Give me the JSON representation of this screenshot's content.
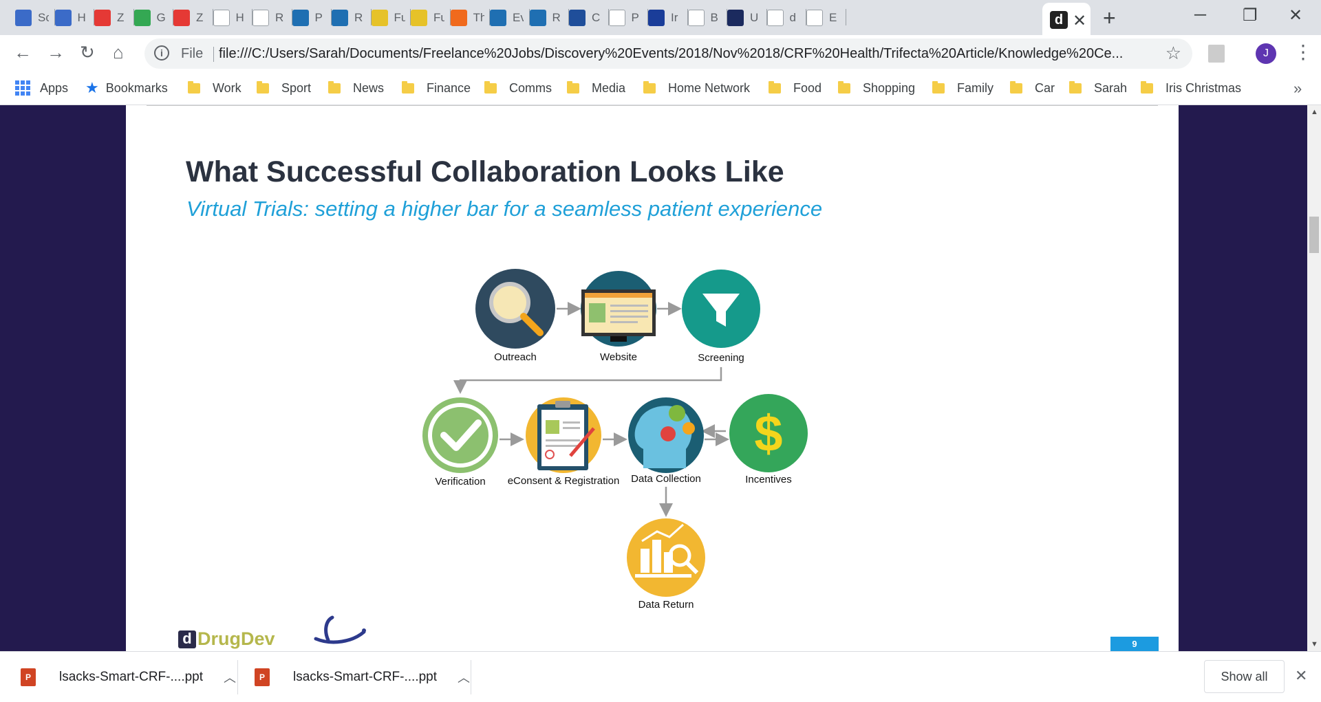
{
  "browser": {
    "tabs": [
      {
        "icon": "confluence-icon",
        "label": "Sc",
        "color": "#3b6bc8"
      },
      {
        "icon": "confluence-icon",
        "label": "H",
        "color": "#3b6bc8"
      },
      {
        "icon": "zoho-icon",
        "label": "Z",
        "color": "#e53935"
      },
      {
        "icon": "maps-icon",
        "label": "G",
        "color": "#34a853"
      },
      {
        "icon": "zoho-icon",
        "label": "Z",
        "color": "#e53935"
      },
      {
        "icon": "document-icon",
        "label": "H",
        "color": "#ffffff"
      },
      {
        "icon": "document-icon",
        "label": "R",
        "color": "#ffffff"
      },
      {
        "icon": "topra-icon",
        "label": "P",
        "color": "#1f6fb2"
      },
      {
        "icon": "raps-icon",
        "label": "R",
        "color": "#1f6fb2"
      },
      {
        "icon": "y-icon",
        "label": "Fu",
        "color": "#e6c229"
      },
      {
        "icon": "y-icon",
        "label": "Fu",
        "color": "#e6c229"
      },
      {
        "icon": "c-icon",
        "label": "Th",
        "color": "#f06a1d"
      },
      {
        "icon": "raps-icon",
        "label": "Ev",
        "color": "#1f6fb2"
      },
      {
        "icon": "raps-icon",
        "label": "R",
        "color": "#1f6fb2"
      },
      {
        "icon": "bars-icon",
        "label": "C",
        "color": "#1f4e9a"
      },
      {
        "icon": "document-icon",
        "label": "P",
        "color": "#ffffff"
      },
      {
        "icon": "eu-flag-icon",
        "label": "Ir",
        "color": "#1a3d99"
      },
      {
        "icon": "b-logo-icon",
        "label": "B",
        "color": "#ffffff"
      },
      {
        "icon": "m-logo-icon",
        "label": "U",
        "color": "#1b2a5e"
      },
      {
        "icon": "google-icon",
        "label": "d",
        "color": "#ffffff"
      },
      {
        "icon": "google-icon",
        "label": "E",
        "color": "#ffffff"
      }
    ],
    "active_tab_icon": "d",
    "new_tab": "+",
    "address": {
      "scheme": "File",
      "url": "file:///C:/Users/Sarah/Documents/Freelance%20Jobs/Discovery%20Events/2018/Nov%2018/CRF%20Health/Trifecta%20Article/Knowledge%20Ce..."
    },
    "profile_initial": "J",
    "bookmarks": {
      "apps": "Apps",
      "bookmarks": "Bookmarks",
      "folders": [
        "Work",
        "Sport",
        "News",
        "Finance",
        "Comms",
        "Media",
        "Home Network",
        "Food",
        "Shopping",
        "Family",
        "Car",
        "Sarah",
        "Iris Christmas"
      ],
      "more": "»"
    }
  },
  "slide": {
    "title": "What Successful Collaboration Looks Like",
    "subtitle": "Virtual Trials: setting a higher bar for a seamless patient experience",
    "steps": {
      "outreach": "Outreach",
      "website": "Website",
      "screening": "Screening",
      "verification": "Verification",
      "econsent": "eConsent & Registration",
      "data_collection": "Data Collection",
      "incentives": "Incentives",
      "data_return": "Data Return"
    },
    "brand_letter": "d",
    "brand": "DrugDev",
    "page_number": "9"
  },
  "downloads": {
    "items": [
      "lsacks-Smart-CRF-....ppt",
      "lsacks-Smart-CRF-....ppt"
    ],
    "show_all": "Show all"
  }
}
